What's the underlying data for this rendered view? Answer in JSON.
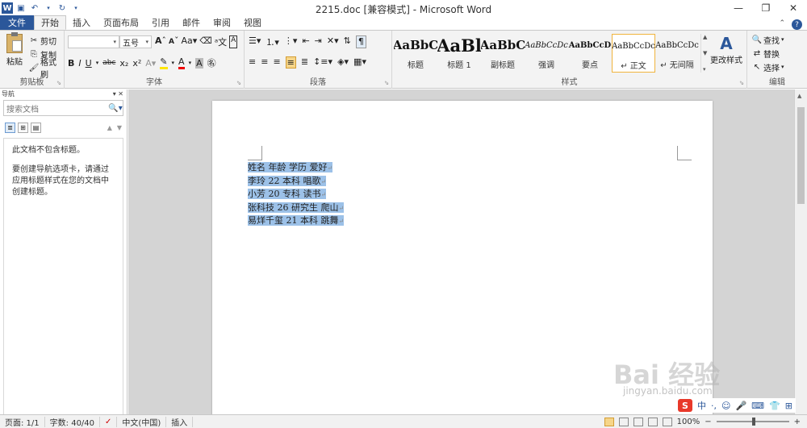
{
  "window": {
    "title": "2215.doc [兼容模式] - Microsoft Word",
    "app_icon": "word-icon"
  },
  "tabs": [
    {
      "label": "文件",
      "active": false,
      "file": true
    },
    {
      "label": "开始",
      "active": true
    },
    {
      "label": "插入",
      "active": false
    },
    {
      "label": "页面布局",
      "active": false
    },
    {
      "label": "引用",
      "active": false
    },
    {
      "label": "邮件",
      "active": false
    },
    {
      "label": "审阅",
      "active": false
    },
    {
      "label": "视图",
      "active": false
    }
  ],
  "clipboard": {
    "paste": "粘贴",
    "cut": "剪切",
    "copy": "复制",
    "format_painter": "格式刷",
    "label": "剪贴板"
  },
  "font": {
    "name_value": "",
    "size_value": "五号",
    "label": "字体"
  },
  "paragraph": {
    "label": "段落"
  },
  "styles": {
    "label": "样式",
    "items": [
      {
        "sample": "AaBbC",
        "name": "标题",
        "selected": false
      },
      {
        "sample": "AaBl",
        "name": "标题 1",
        "selected": false
      },
      {
        "sample": "AaBbC",
        "name": "副标题",
        "selected": false
      },
      {
        "sample": "AaBbCcDc",
        "name": "强调",
        "selected": false
      },
      {
        "sample": "AaBbCcD",
        "name": "要点",
        "selected": false
      },
      {
        "sample": "AaBbCcDc",
        "name": "↵ 正文",
        "selected": true
      },
      {
        "sample": "AaBbCcDc",
        "name": "↵ 无间隔",
        "selected": false
      }
    ],
    "change_styles": "更改样式"
  },
  "editing": {
    "find": "查找",
    "replace": "替换",
    "select": "选择",
    "label": "编辑"
  },
  "nav": {
    "title": "导航",
    "search_placeholder": "搜索文档",
    "msg1": "此文档不包含标题。",
    "msg2": "要创建导航选项卡，请通过应用标题样式在您的文档中创建标题。"
  },
  "document": {
    "lines": [
      "姓名 年龄 学历 爱好",
      "李玲 22 本科 唱歌",
      "小芳 20 专科 读书",
      "张科技 26 研究生 爬山",
      "易烊千玺 21 本科 跳舞"
    ],
    "paragraph_mark": "↵",
    "selection_color": "#9cc1e8"
  },
  "status": {
    "page": "页面: 1/1",
    "words": "字数: 40/40",
    "language": "中文(中国)",
    "mode": "插入",
    "zoom": "100%"
  },
  "ime": {
    "logo": "S",
    "mode": "中"
  },
  "watermark": {
    "text": "Bai 经验",
    "sub": "jingyan.baidu.com"
  },
  "colors": {
    "brand": "#2b579a",
    "ribbon_bg": "#f3f3f3",
    "doc_bg": "#d4d4d4"
  }
}
